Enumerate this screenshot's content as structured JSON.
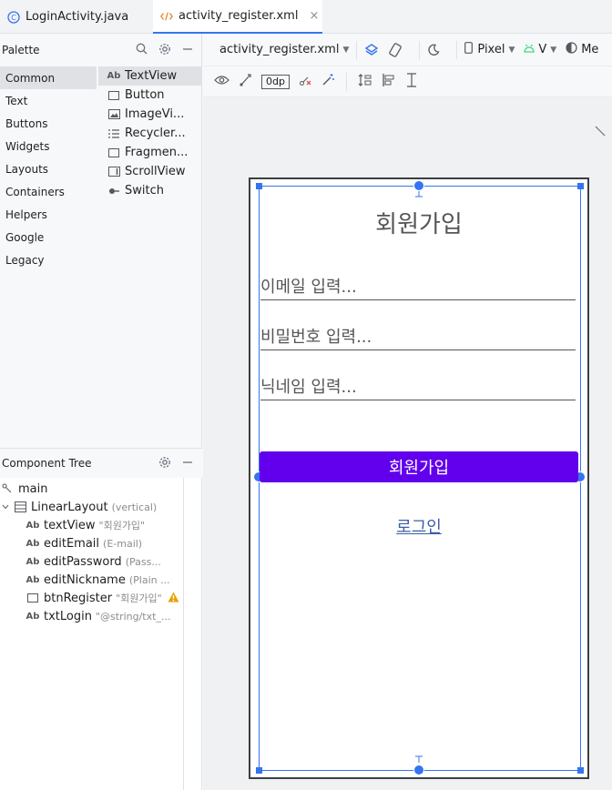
{
  "tabs": [
    {
      "label": "LoginActivity.java",
      "icon": "class-c-icon",
      "active": false
    },
    {
      "label": "activity_register.xml",
      "icon": "xml-code-icon",
      "active": true,
      "close": "×"
    }
  ],
  "palette": {
    "title": "Palette",
    "categories": [
      "Common",
      "Text",
      "Buttons",
      "Widgets",
      "Layouts",
      "Containers",
      "Helpers",
      "Google",
      "Legacy"
    ],
    "items": [
      {
        "icon": "Ab",
        "label": "TextView"
      },
      {
        "icon": "button-icon",
        "label": "Button"
      },
      {
        "icon": "image-icon",
        "label": "ImageVi..."
      },
      {
        "icon": "list-icon",
        "label": "Recycler..."
      },
      {
        "icon": "fragment-icon",
        "label": "Fragmen..."
      },
      {
        "icon": "scroll-icon",
        "label": "ScrollView"
      },
      {
        "icon": "switch-icon",
        "label": "Switch"
      }
    ]
  },
  "component_tree": {
    "title": "Component Tree",
    "rows": [
      {
        "icon": "",
        "label": "main",
        "sub": ""
      },
      {
        "icon": "",
        "label": "LinearLayout",
        "sub": "(vertical)"
      },
      {
        "icon": "Ab",
        "label": "textView",
        "sub": "\"회원가입\""
      },
      {
        "icon": "Ab",
        "label": "editEmail",
        "sub": "(E-mail)"
      },
      {
        "icon": "Ab",
        "label": "editPassword",
        "sub": "(Pass..."
      },
      {
        "icon": "Ab",
        "label": "editNickname",
        "sub": "(Plain ..."
      },
      {
        "icon": "",
        "label": "btnRegister",
        "sub": "\"회원가입\""
      },
      {
        "icon": "Ab",
        "label": "txtLogin",
        "sub": "\"@string/txt_..."
      }
    ]
  },
  "toolbar": {
    "file": "activity_register.xml",
    "device": "Pixel",
    "api": "V",
    "theme": "Me",
    "margin": "0dp"
  },
  "preview": {
    "title": "회원가입",
    "email_hint": "이메일 입력...",
    "password_hint": "비밀번호 입력...",
    "nickname_hint": "닉네임 입력...",
    "register_button": "회원가입",
    "login_link": "로그인",
    "button_color": "#6200ee",
    "selection_color": "#3574f0"
  }
}
